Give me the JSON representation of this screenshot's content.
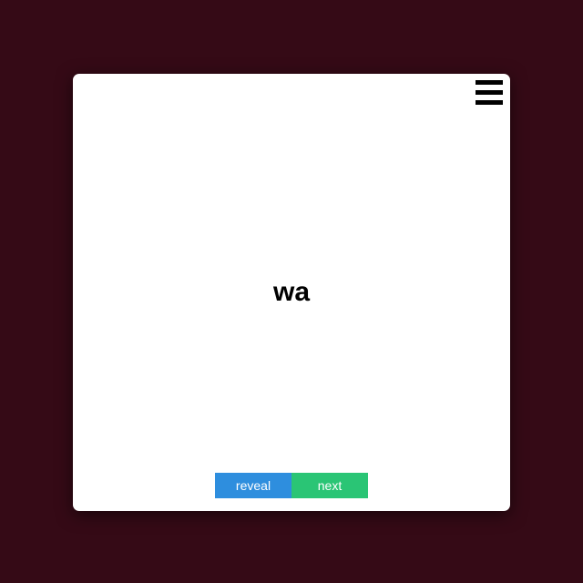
{
  "card": {
    "word": "wa"
  },
  "menu": {
    "icon": "hamburger-menu-icon"
  },
  "buttons": {
    "reveal_label": "reveal",
    "next_label": "next"
  },
  "colors": {
    "background": "#350a16",
    "card": "#ffffff",
    "reveal": "#2e8ede",
    "next": "#2ac575"
  }
}
